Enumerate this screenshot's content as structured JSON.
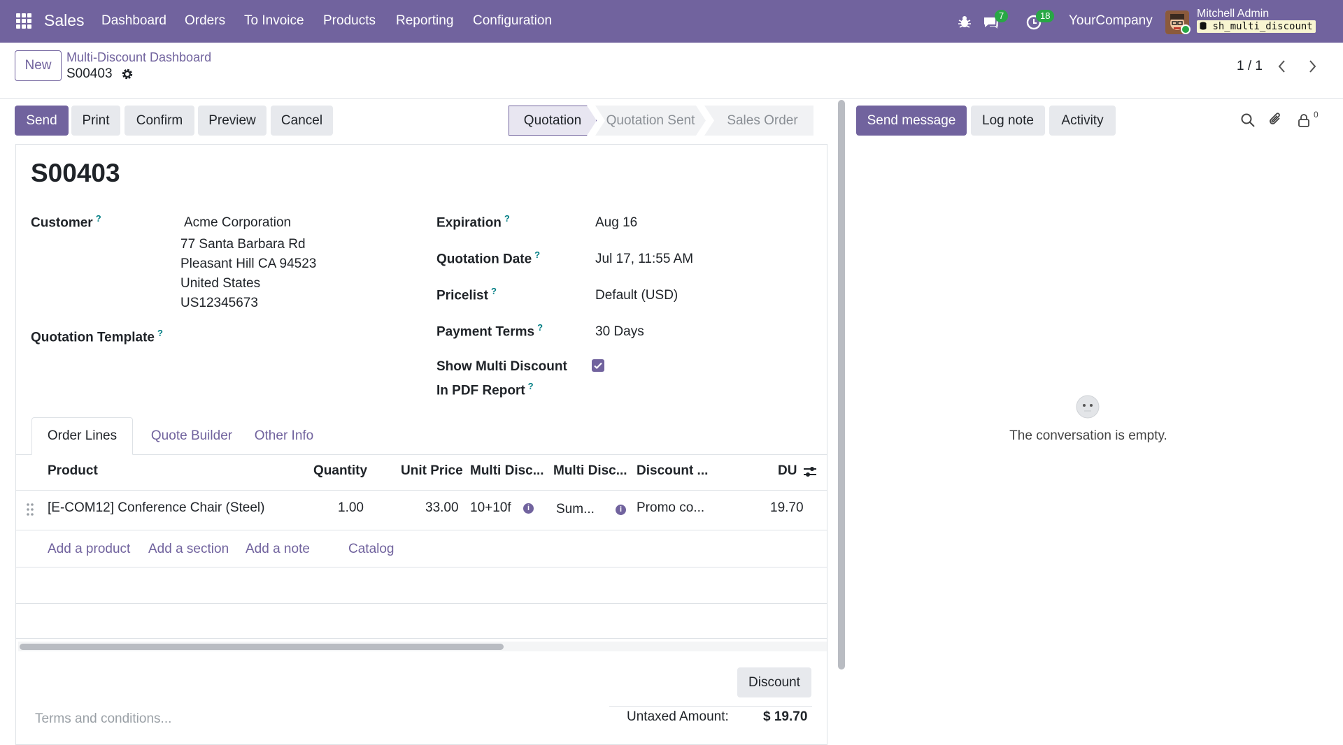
{
  "topbar": {
    "app_name": "Sales",
    "menu": [
      "Dashboard",
      "Orders",
      "To Invoice",
      "Products",
      "Reporting",
      "Configuration"
    ],
    "messages_count": "7",
    "activities_count": "18",
    "company": "YourCompany",
    "user_name": "Mitchell Admin",
    "database": "sh_multi_discount"
  },
  "control_panel": {
    "new_label": "New",
    "breadcrumb_parent": "Multi-Discount Dashboard",
    "breadcrumb_current": "S00403",
    "pager": "1 / 1",
    "actions": [
      "Send",
      "Print",
      "Confirm",
      "Preview",
      "Cancel"
    ],
    "stages": [
      "Quotation",
      "Quotation Sent",
      "Sales Order"
    ],
    "active_stage": "Quotation"
  },
  "form": {
    "title": "S00403",
    "customer_label": "Customer",
    "customer_name": "Acme Corporation",
    "customer_address": [
      "77 Santa Barbara Rd",
      "Pleasant Hill CA 94523",
      "United States",
      "US12345673"
    ],
    "template_label": "Quotation Template",
    "expiration_label": "Expiration",
    "expiration_value": "Aug 16",
    "quotation_date_label": "Quotation Date",
    "quotation_date_value": "Jul 17, 11:55 AM",
    "pricelist_label": "Pricelist",
    "pricelist_value": "Default (USD)",
    "payment_terms_label": "Payment Terms",
    "payment_terms_value": "30 Days",
    "show_multi_label_line1": "Show Multi Discount",
    "show_multi_label_line2": "In PDF Report",
    "show_multi_checked": true
  },
  "tabs": [
    "Order Lines",
    "Quote Builder",
    "Other Info"
  ],
  "order_lines": {
    "columns": [
      "Product",
      "Quantity",
      "Unit Price",
      "Multi Disc...",
      "Multi Disc...",
      "Discount ...",
      "DU"
    ],
    "rows": [
      {
        "product": "[E-COM12] Conference Chair (Steel)",
        "quantity": "1.00",
        "unit_price": "33.00",
        "multi_disc_1": "10+10f",
        "multi_disc_2": "Sum...",
        "discount": "Promo co...",
        "du": "19.70"
      }
    ],
    "add_links": [
      "Add a product",
      "Add a section",
      "Add a note",
      "Catalog"
    ]
  },
  "footer": {
    "discount_button": "Discount",
    "terms_placeholder": "Terms and conditions...",
    "untaxed_label": "Untaxed Amount:",
    "untaxed_value": "$ 19.70"
  },
  "chatter": {
    "send_message": "Send message",
    "log_note": "Log note",
    "activity": "Activity",
    "followers_count": "0",
    "empty_text": "The conversation is empty."
  },
  "colors": {
    "brand": "#71639e",
    "badge": "#28a745",
    "help": "#017e84"
  }
}
